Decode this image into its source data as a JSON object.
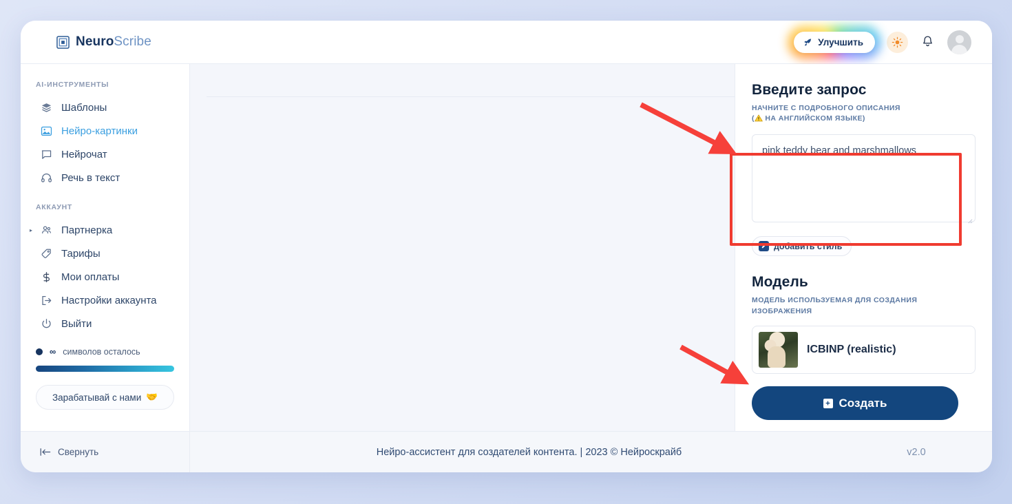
{
  "brand": {
    "name_bold": "Neuro",
    "name_light": "Scribe",
    "icon": "nested-square-logo-icon"
  },
  "topbar": {
    "upgrade_label": "Улучшить",
    "upgrade_icon": "rocket-icon",
    "theme_icon": "sun-icon",
    "notifications_icon": "bell-icon",
    "avatar_icon": "user-avatar-icon"
  },
  "sidebar": {
    "section_tools_title": "AI-ИНСТРУМЕНТЫ",
    "tools": [
      {
        "label": "Шаблоны",
        "icon": "layers-icon",
        "active": false
      },
      {
        "label": "Нейро-картинки",
        "icon": "image-icon",
        "active": true
      },
      {
        "label": "Нейрочат",
        "icon": "chat-bubble-icon",
        "active": false
      },
      {
        "label": "Речь в текст",
        "icon": "headphones-icon",
        "active": false
      }
    ],
    "section_account_title": "АККАУНТ",
    "account": [
      {
        "label": "Партнерка",
        "icon": "users-icon",
        "caret": "▸"
      },
      {
        "label": "Тарифы",
        "icon": "tag-icon",
        "caret": ""
      },
      {
        "label": "Мои оплаты",
        "icon": "dollar-icon",
        "caret": ""
      },
      {
        "label": "Настройки аккаунта",
        "icon": "logout-bracket-icon",
        "caret": ""
      },
      {
        "label": "Выйти",
        "icon": "power-icon",
        "caret": ""
      }
    ],
    "quota_symbol": "∞",
    "quota_label": "символов осталось",
    "promo_label": "Зарабатывай с нами",
    "promo_emoji": "🤝"
  },
  "panel": {
    "prompt_title": "Введите запрос",
    "prompt_sub_line1": "НАЧНИТЕ С ПОДРОБНОГО ОПИСАНИЯ",
    "prompt_sub_line2_prefix": "(",
    "prompt_sub_line2": "НА АНГЛИЙСКОМ ЯЗЫКЕ)",
    "prompt_warn_icon": "warning-triangle-icon",
    "prompt_value": "pink teddy bear and marshmallows",
    "prompt_placeholder": "pink teddy bear and marshmallows",
    "style_btn_label": "добавить стиль",
    "style_btn_icon": "pencil-square-icon",
    "model_title": "Модель",
    "model_sub": "МОДЕЛЬ ИСПОЛЬЗУЕМАЯ ДЛЯ СОЗДАНИЯ ИЗОБРАЖЕНИЯ",
    "model_name": "ICBINP (realistic)",
    "create_label": "Создать",
    "create_icon": "plus-square-icon"
  },
  "footer": {
    "collapse_label": "Свернуть",
    "collapse_icon": "collapse-left-icon",
    "center_text": "Нейро-ассистент для создателей контента.  |  2023 © Нейроскрайб",
    "version": "v2.0"
  },
  "annotations": {
    "accent_red": "#f03b30",
    "arrow_1": "points-to-prompt-textarea",
    "arrow_2": "points-to-create-button",
    "highlight_1": "prompt-textarea-red-box"
  },
  "colors": {
    "brand_dark": "#17345f",
    "brand_light": "#6e93c4",
    "active_blue": "#3b9fe0",
    "primary_button": "#13467e",
    "page_bg": "#d5def4"
  }
}
